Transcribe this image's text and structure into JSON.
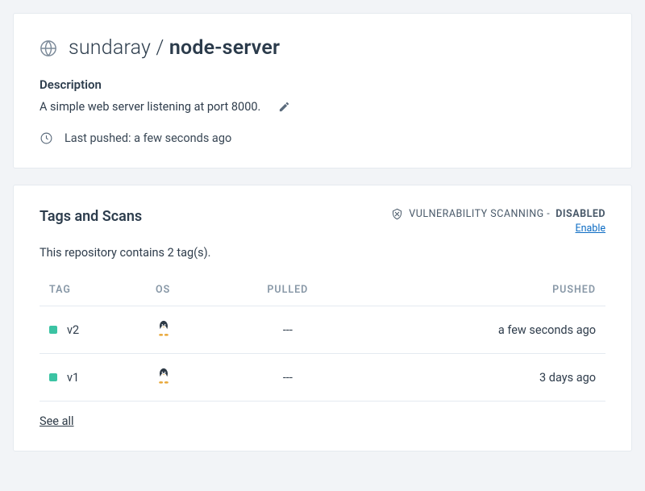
{
  "header": {
    "namespace": "sundaray",
    "separator": " / ",
    "repo": "node-server"
  },
  "description": {
    "heading": "Description",
    "text": "A simple web server listening at port 8000."
  },
  "last_pushed": {
    "label": "Last pushed: a few seconds ago"
  },
  "tags": {
    "heading": "Tags and Scans",
    "vuln_label": "VULNERABILITY SCANNING - ",
    "vuln_state": "DISABLED",
    "enable_label": "Enable",
    "count_text": "This repository contains 2 tag(s).",
    "columns": {
      "tag": "TAG",
      "os": "OS",
      "pulled": "PULLED",
      "pushed": "PUSHED"
    },
    "rows": [
      {
        "name": "v2",
        "os": "linux",
        "pulled": "---",
        "pushed": "a few seconds ago"
      },
      {
        "name": "v1",
        "os": "linux",
        "pulled": "---",
        "pushed": "3 days ago"
      }
    ],
    "see_all": "See all"
  }
}
